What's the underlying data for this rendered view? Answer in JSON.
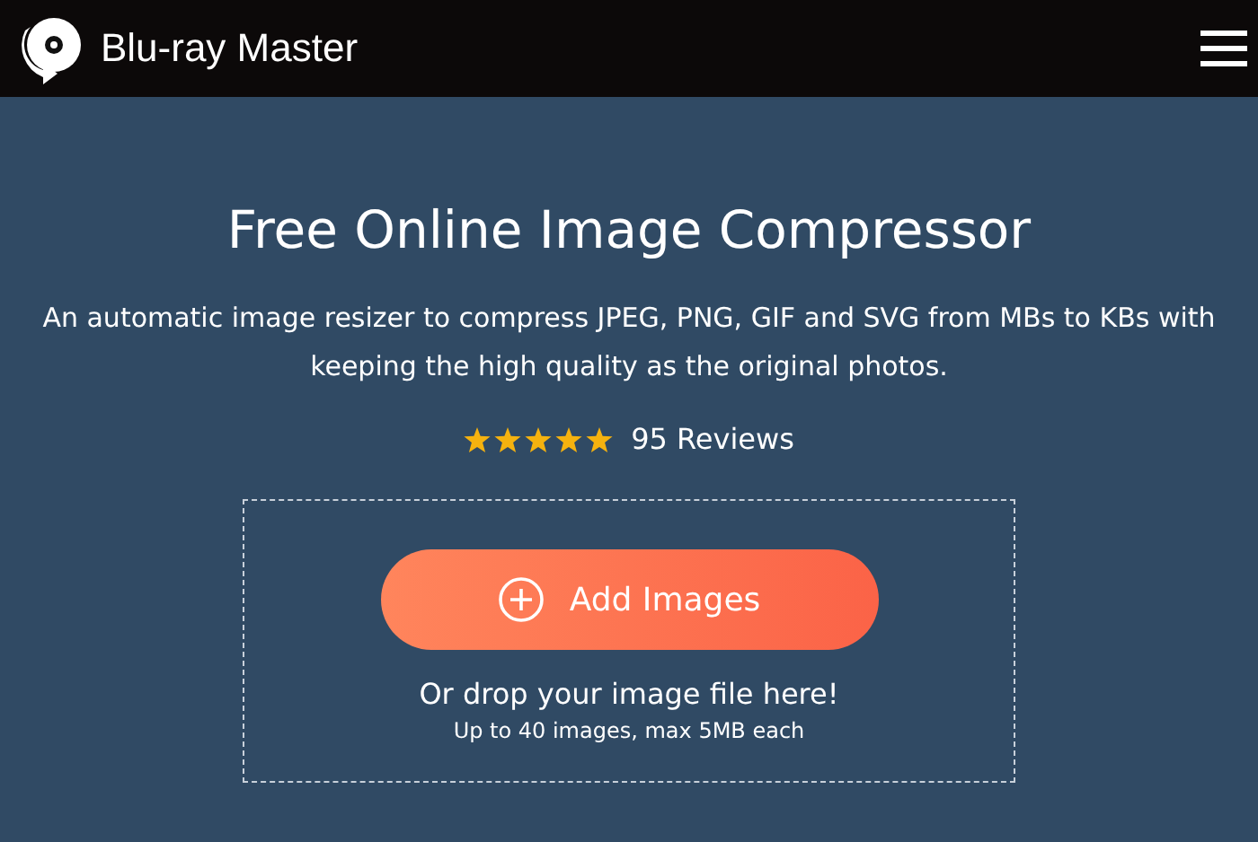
{
  "header": {
    "brand": "Blu-ray Master"
  },
  "hero": {
    "title": "Free Online Image Compressor",
    "description": "An automatic image resizer to compress JPEG, PNG, GIF and SVG from MBs to KBs with keeping the high quality as the original photos.",
    "stars": 5,
    "reviews": "95 Reviews"
  },
  "upload": {
    "button": "Add Images",
    "hint": "Or drop your image file here!",
    "limit": "Up to 40 images, max 5MB each"
  }
}
